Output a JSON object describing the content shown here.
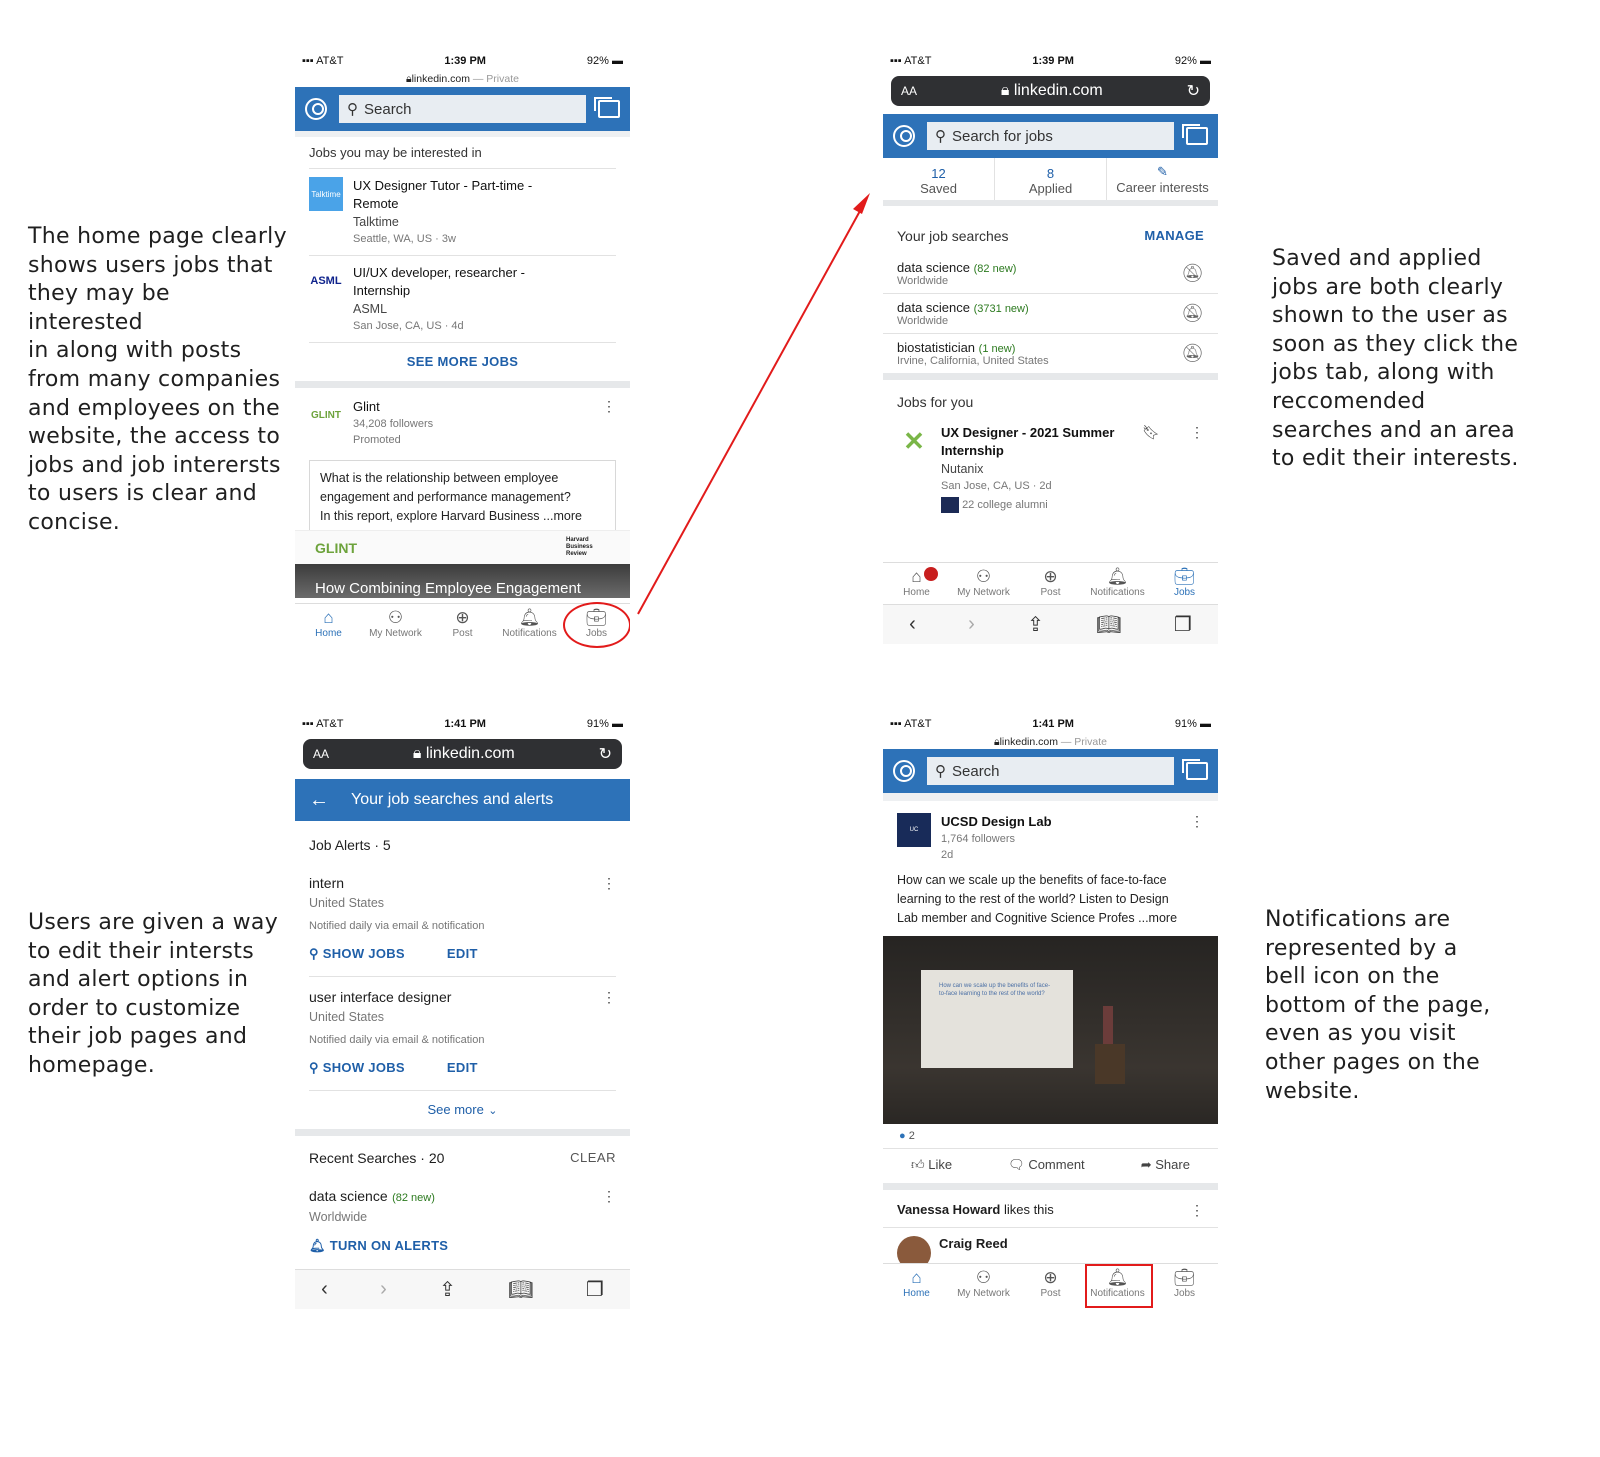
{
  "captions": {
    "home": [
      "The home page clearly",
      "shows users jobs that",
      "they may be interested",
      "in along with posts",
      "from many companies",
      "and employees on the",
      "website, the access to",
      "jobs and job interersts",
      "to users is clear and",
      "concise."
    ],
    "jobs": [
      "Saved and applied",
      "jobs are both clearly",
      "shown to the user as",
      "soon as they click the",
      "jobs tab, along with",
      "reccomended",
      "searches and an area",
      "to edit their interests."
    ],
    "alerts": [
      "Users are given a way",
      "to edit their intersts",
      "and alert options in",
      "order to customize",
      "their job pages and",
      "homepage."
    ],
    "notifications": [
      "Notifications are",
      "represented by a",
      "bell icon on the",
      "bottom of the page,",
      "even as you visit",
      "other pages on the",
      "website."
    ]
  },
  "colors": {
    "linkedin_blue": "#2d72b8",
    "annotation_red": "#e21b1b",
    "link_blue": "#1f5fa8",
    "new_green": "#2c7a1f"
  },
  "tabs": [
    "Home",
    "My Network",
    "Post",
    "Notifications",
    "Jobs"
  ],
  "screen1": {
    "carrier": "AT&T",
    "time": "1:39 PM",
    "battery": "92%",
    "url": "linkedin.com",
    "private": "— Private",
    "search_placeholder": "Search",
    "jobs_header": "Jobs you may be interested in",
    "jobs": [
      {
        "logo": "Talktime",
        "title": "UX Designer Tutor - Part-time -",
        "title2": "Remote",
        "company": "Talktime",
        "location": "Seattle, WA, US · 3w"
      },
      {
        "logo": "ASML",
        "title": "UI/UX developer, researcher -",
        "title2": "Internship",
        "company": "ASML",
        "location": "San Jose, CA, US · 4d"
      }
    ],
    "see_more": "SEE MORE JOBS",
    "post": {
      "company": "Glint",
      "logo": "GLINT",
      "followers": "34,208 followers",
      "promoted": "Promoted",
      "text1": "What is the relationship between employee",
      "text2": "engagement and performance management?",
      "text3": "In this report, explore Harvard Business",
      "more": "...more",
      "banner_logo": "GLINT",
      "banner_right": "Harvard Business Review",
      "image_title": "How Combining Employee Engagement"
    }
  },
  "screen2": {
    "carrier": "AT&T",
    "time": "1:39 PM",
    "battery": "92%",
    "aa": "AA",
    "url": "linkedin.com",
    "search_placeholder": "Search for jobs",
    "stats": [
      {
        "value": "12",
        "label": "Saved"
      },
      {
        "value": "8",
        "label": "Applied"
      },
      {
        "value": "✎",
        "label": "Career interests"
      }
    ],
    "searches_title": "Your job searches",
    "manage": "MANAGE",
    "searches": [
      {
        "term": "data science",
        "new": "(82 new)",
        "loc": "Worldwide"
      },
      {
        "term": "data science",
        "new": "(3731 new)",
        "loc": "Worldwide"
      },
      {
        "term": "biostatistician",
        "new": "(1 new)",
        "loc": "Irvine, California, United States"
      }
    ],
    "for_you": "Jobs for you",
    "job": {
      "title": "UX Designer - 2021 Summer",
      "title2": "Internship",
      "company": "Nutanix",
      "location": "San Jose, CA, US · 2d",
      "alumni": "22 college alumni"
    }
  },
  "screen3": {
    "carrier": "AT&T",
    "time": "1:41 PM",
    "battery": "91%",
    "aa": "AA",
    "url": "linkedin.com",
    "header": "Your job searches and alerts",
    "alerts_title": "Job Alerts · 5",
    "alerts": [
      {
        "term": "intern",
        "loc": "United States",
        "notify": "Notified daily via email & notification"
      },
      {
        "term": "user interface designer",
        "loc": "United States",
        "notify": "Notified daily via email & notification"
      }
    ],
    "show_jobs": "SHOW JOBS",
    "edit": "EDIT",
    "see_more": "See more",
    "recent_title": "Recent Searches · 20",
    "clear": "CLEAR",
    "recent": {
      "term": "data science",
      "new": "(82 new)",
      "loc": "Worldwide"
    },
    "turn_on": "TURN ON ALERTS"
  },
  "screen4": {
    "carrier": "AT&T",
    "time": "1:41 PM",
    "battery": "91%",
    "url": "linkedin.com",
    "private": "— Private",
    "search_placeholder": "Search",
    "post": {
      "company": "UCSD Design Lab",
      "followers": "1,764 followers",
      "age": "2d",
      "text1": "How can we scale up the benefits of face-to-face",
      "text2": "learning to the rest of the world? Listen to Design",
      "text3": "Lab member and Cognitive Science Profes",
      "more": "...more",
      "slide": "How can we scale up the benefits of face-to-face learning to the rest of the world?",
      "reactions": "2"
    },
    "actions": [
      "Like",
      "Comment",
      "Share"
    ],
    "liker": "Vanessa Howard",
    "likes_suffix": "likes this",
    "next_author": "Craig Reed"
  }
}
